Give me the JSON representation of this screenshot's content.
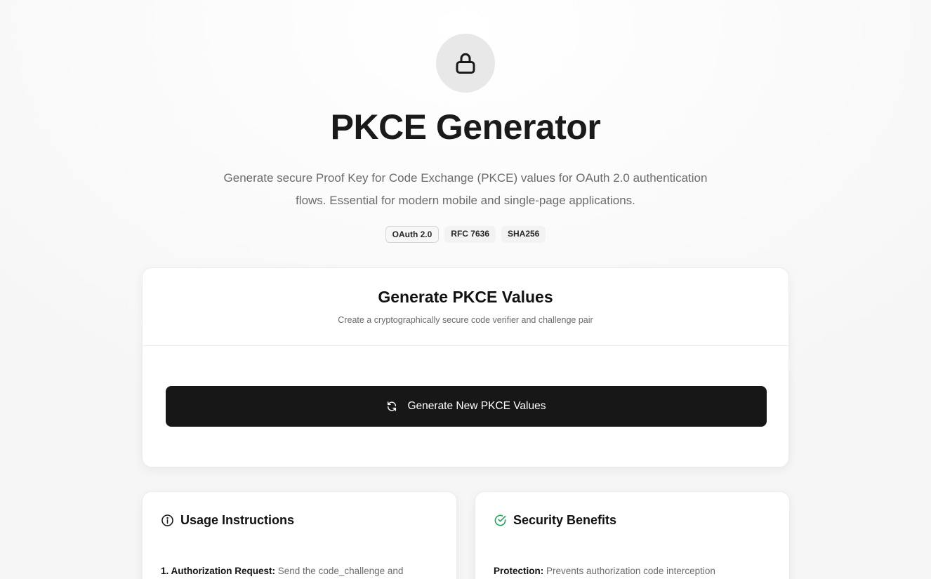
{
  "hero": {
    "icon": "lock-icon",
    "title": "PKCE Generator",
    "subtitle": "Generate secure Proof Key for Code Exchange (PKCE) values for OAuth 2.0 authentication flows. Essential for modern mobile and single-page applications.",
    "badges": [
      "OAuth 2.0",
      "RFC 7636",
      "SHA256"
    ]
  },
  "generator": {
    "title": "Generate PKCE Values",
    "description": "Create a cryptographically secure code verifier and challenge pair",
    "button_icon": "refresh-icon",
    "button_label": "Generate New PKCE Values"
  },
  "usage": {
    "icon": "info-icon",
    "title": "Usage Instructions",
    "first_item_label": "1. Authorization Request:",
    "first_item_text": " Send the code_challenge and"
  },
  "security": {
    "icon": "check-circle-icon",
    "icon_color": "#22a35a",
    "title": "Security Benefits",
    "first_item_label": "Protection:",
    "first_item_text": " Prevents authorization code interception"
  }
}
